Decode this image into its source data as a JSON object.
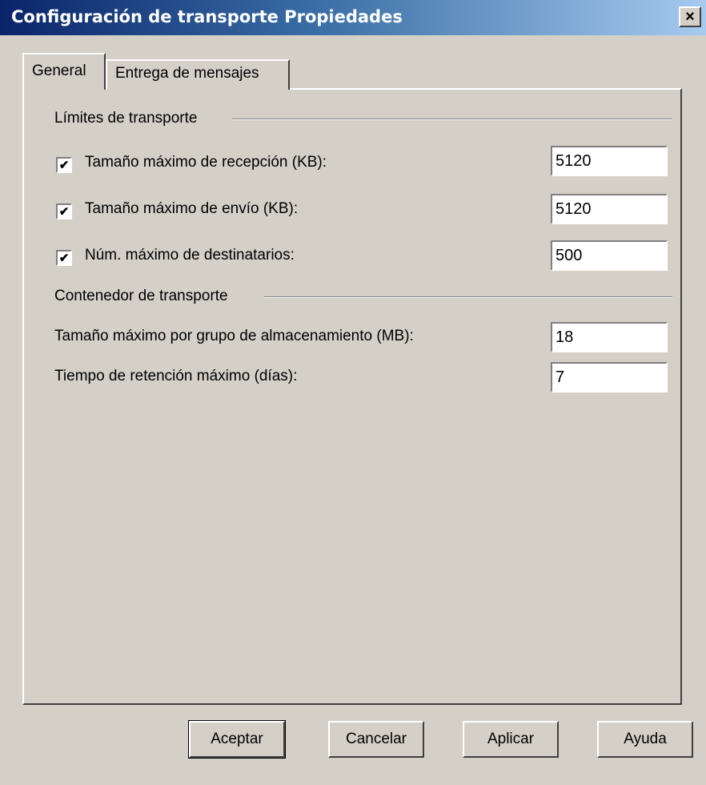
{
  "window": {
    "title": "Configuración de transporte Propiedades",
    "close_glyph": "×"
  },
  "tabs": [
    {
      "label": "General",
      "active": true
    },
    {
      "label": "Entrega de mensajes",
      "active": false
    }
  ],
  "limits_group": {
    "title": "Límites de transporte",
    "rows": [
      {
        "label": "Tamaño máximo de recepción (KB):",
        "checked": true,
        "value": "5120"
      },
      {
        "label": "Tamaño máximo de envío (KB):",
        "checked": true,
        "value": "5120"
      },
      {
        "label": "Núm. máximo de destinatarios:",
        "checked": true,
        "value": "500"
      }
    ]
  },
  "container_group": {
    "title": "Contenedor de transporte",
    "rows": [
      {
        "label": "Tamaño máximo por grupo de almacenamiento (MB):",
        "value": "18"
      },
      {
        "label": "Tiempo de retención máximo (días):",
        "value": "7"
      }
    ]
  },
  "buttons": {
    "ok": "Aceptar",
    "cancel": "Cancelar",
    "apply": "Aplicar",
    "help": "Ayuda"
  },
  "check_glyph": "✔",
  "colors": {
    "title_bar_start": "#0a246a",
    "title_bar_end": "#a6caf0",
    "face": "#d4d0c8"
  }
}
